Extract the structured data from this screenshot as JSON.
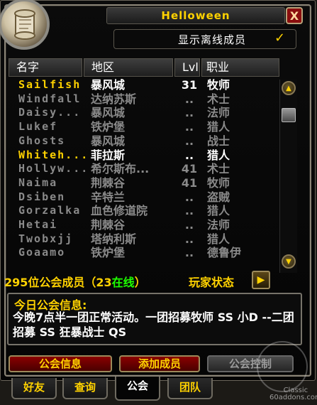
{
  "window": {
    "title": "Helloween",
    "close_label": "X"
  },
  "show_offline": {
    "label": "显示离线成员",
    "checked": true,
    "check_glyph": "✓"
  },
  "columns": {
    "name": "名字",
    "zone": "地区",
    "level": "Lvl",
    "class": "职业"
  },
  "members": [
    {
      "name": "Sailfish",
      "zone": "暴风城",
      "level": "31",
      "class": "牧师",
      "online": true
    },
    {
      "name": "Windfall",
      "zone": "达纳苏斯",
      "level": "..",
      "class": "术士",
      "online": false
    },
    {
      "name": "Daisy...",
      "zone": "暴风城",
      "level": "..",
      "class": "法师",
      "online": false
    },
    {
      "name": "Lukef",
      "zone": "铁炉堡",
      "level": "..",
      "class": "猎人",
      "online": false
    },
    {
      "name": "Ghosts",
      "zone": "暴风城",
      "level": "..",
      "class": "战士",
      "online": false
    },
    {
      "name": "Whiteh...",
      "zone": "菲拉斯",
      "level": "..",
      "class": "猎人",
      "online": true
    },
    {
      "name": "Hollyw...",
      "zone": "希尔斯布...",
      "level": "41",
      "class": "术士",
      "online": false
    },
    {
      "name": "Naima",
      "zone": "荆棘谷",
      "level": "41",
      "class": "牧师",
      "online": false
    },
    {
      "name": "Dsiben",
      "zone": "辛特兰",
      "level": "..",
      "class": "盗贼",
      "online": false
    },
    {
      "name": "Gorzalka",
      "zone": "血色修道院",
      "level": "..",
      "class": "猎人",
      "online": false
    },
    {
      "name": "Hetai",
      "zone": "荆棘谷",
      "level": "..",
      "class": "法师",
      "online": false
    },
    {
      "name": "Twobxjj",
      "zone": "塔纳利斯",
      "level": "..",
      "class": "猎人",
      "online": false
    },
    {
      "name": "Goaamo",
      "zone": "铁炉堡",
      "level": "..",
      "class": "德鲁伊",
      "online": false
    }
  ],
  "scroll": {
    "up": "▲",
    "down": "▼"
  },
  "summary": {
    "prefix": "295位公会成员（23",
    "online": "在线",
    "suffix": "）",
    "player_status": "玩家状态",
    "arrow": "▶"
  },
  "motd": {
    "title": "今日公会信息:",
    "text": "今晚7点半一团正常活动。一团招募牧师 SS 小D --二团招募 SS 狂暴战士 QS"
  },
  "buttons": {
    "guild_info": "公会信息",
    "add_member": "添加成员",
    "guild_control": "公会控制"
  },
  "tabs": [
    "好友",
    "查询",
    "公会",
    "团队"
  ],
  "watermark": {
    "line1": "Classic",
    "line2": "60addons.com"
  },
  "colors": {
    "online_name": "#ffd200",
    "offline": "#8a8a8a",
    "online_text": "#1eff00",
    "button_red": "#8a0000"
  }
}
